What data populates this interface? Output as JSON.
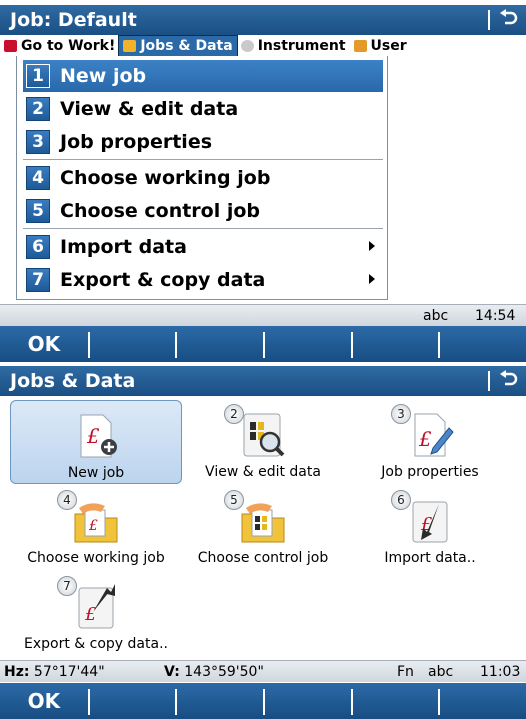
{
  "top_screen": {
    "title": "Job: Default",
    "menubar": [
      {
        "label": "Go to Work!",
        "icon": "work-icon",
        "color": "#c8102e"
      },
      {
        "label": "Jobs & Data",
        "icon": "jobs-data-icon",
        "color": "#f2b32b"
      },
      {
        "label": "Instrument",
        "icon": "instrument-icon",
        "color": "#c9c9c9"
      },
      {
        "label": "User",
        "icon": "user-icon",
        "color": "#e39a2a"
      }
    ],
    "dropdown": [
      {
        "num": "1",
        "label": "New job",
        "submenu": false
      },
      {
        "num": "2",
        "label": "View & edit data",
        "submenu": false
      },
      {
        "num": "3",
        "label": "Job properties",
        "submenu": false
      },
      {
        "num": "4",
        "label": "Choose working job",
        "submenu": false
      },
      {
        "num": "5",
        "label": "Choose control job",
        "submenu": false
      },
      {
        "num": "6",
        "label": "Import data",
        "submenu": true
      },
      {
        "num": "7",
        "label": "Export & copy data",
        "submenu": true
      }
    ],
    "status": {
      "mode": "abc",
      "time": "14:54"
    },
    "softkeys": [
      "OK",
      "",
      "",
      "",
      "",
      ""
    ]
  },
  "bottom_screen": {
    "title": "Jobs & Data",
    "tiles": [
      {
        "num": "",
        "label": "New job",
        "icon": "new-job-icon"
      },
      {
        "num": "2",
        "label": "View & edit data",
        "icon": "view-edit-data-icon"
      },
      {
        "num": "3",
        "label": "Job properties",
        "icon": "job-properties-icon"
      },
      {
        "num": "4",
        "label": "Choose working job",
        "icon": "choose-working-job-icon"
      },
      {
        "num": "5",
        "label": "Choose control job",
        "icon": "choose-control-job-icon"
      },
      {
        "num": "6",
        "label": "Import data..",
        "icon": "import-data-icon"
      },
      {
        "num": "7",
        "label": "Export & copy data..",
        "icon": "export-copy-data-icon"
      }
    ],
    "status": {
      "hz_label": "Hz:",
      "hz_value": "57°17'44\"",
      "v_label": "V:",
      "v_value": "143°59'50\"",
      "fn": "Fn",
      "mode": "abc",
      "time": "11:03"
    },
    "softkeys": [
      "OK",
      "",
      "",
      "",
      "",
      ""
    ]
  },
  "colors": {
    "accent": "#1f5a92",
    "selection": "#2e72b8",
    "tile_selected": "#c8dcf2"
  }
}
